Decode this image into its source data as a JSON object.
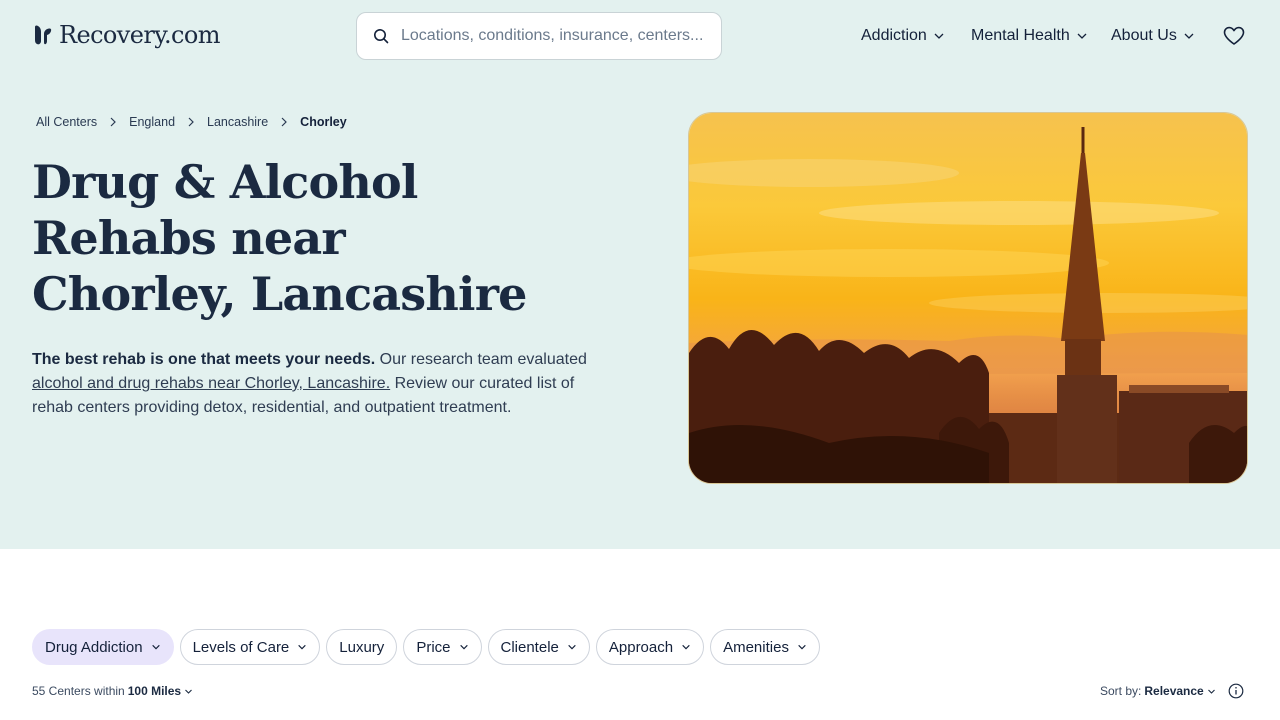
{
  "header": {
    "logo_text": "Recovery.com",
    "search_placeholder": "Locations, conditions, insurance, centers...",
    "nav": [
      {
        "label": "Addiction"
      },
      {
        "label": "Mental Health"
      },
      {
        "label": "About Us"
      }
    ],
    "icons": {
      "search": "search-icon",
      "heart": "heart-icon",
      "chevron": "chevron-down-icon"
    }
  },
  "breadcrumb": [
    {
      "label": "All Centers"
    },
    {
      "label": "England"
    },
    {
      "label": "Lancashire"
    },
    {
      "label": "Chorley"
    }
  ],
  "hero": {
    "title_lines": [
      "Drug & Alcohol",
      "Rehabs near",
      "Chorley, Lancashire"
    ],
    "intro_bold": "The best rehab is one that meets your needs.",
    "intro_text1": " Our research team evaluated ",
    "intro_link": "alcohol and drug rehabs near Chorley, Lancashire.",
    "intro_text2": " Review our curated list of rehab centers providing detox, residential, and outpatient treatment."
  },
  "filters": [
    {
      "label": "Drug Addiction",
      "active": true
    },
    {
      "label": "Levels of Care",
      "active": false
    },
    {
      "label": "Luxury",
      "active": false
    },
    {
      "label": "Price",
      "active": false
    },
    {
      "label": "Clientele",
      "active": false
    },
    {
      "label": "Approach",
      "active": false
    },
    {
      "label": "Amenities",
      "active": false
    }
  ],
  "results": {
    "count_text": "55 Centers within",
    "radius": "100 Miles",
    "sort_label": "Sort by:",
    "sort_value": "Relevance"
  },
  "colors": {
    "hero_bg": "#e3f1ef",
    "active_chip": "#e8e4fb",
    "text": "#1b2a41"
  }
}
